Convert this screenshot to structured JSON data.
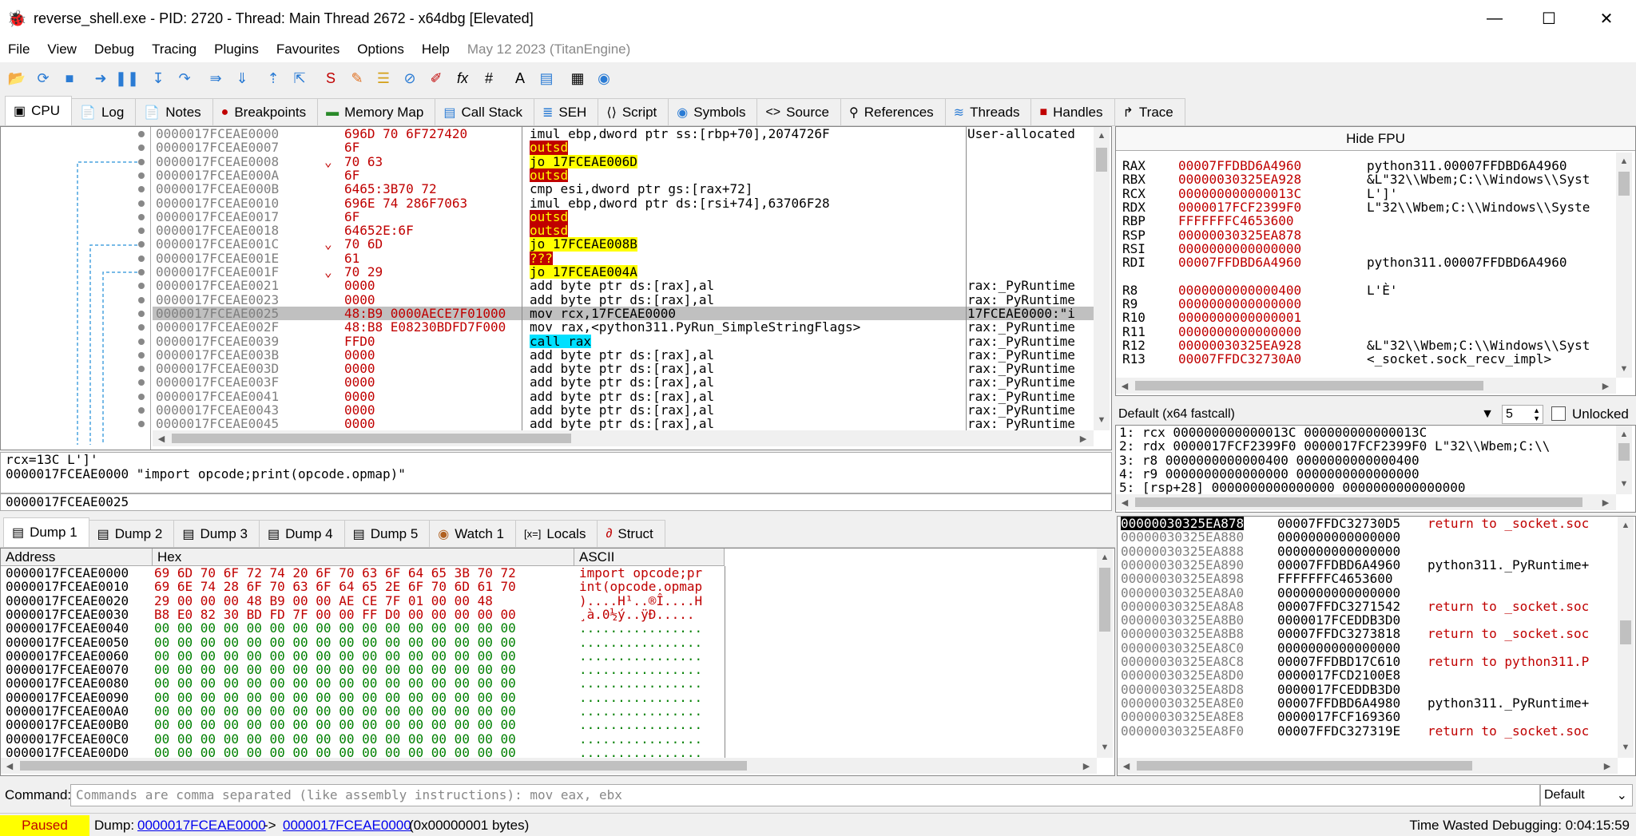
{
  "window": {
    "title": "reverse_shell.exe - PID: 2720 - Thread: Main Thread 2672 - x64dbg [Elevated]",
    "minimize": "—",
    "maximize": "☐",
    "close": "✕"
  },
  "menu": {
    "items": [
      "File",
      "View",
      "Debug",
      "Tracing",
      "Plugins",
      "Favourites",
      "Options",
      "Help"
    ],
    "date": "May 12 2023 (TitanEngine)"
  },
  "toolbar": {
    "icons": [
      "open-icon",
      "restart-icon",
      "close-icon",
      "run-icon",
      "pause-icon",
      "step-into-icon",
      "step-over-icon",
      "trace-into-icon",
      "trace-over-icon",
      "execute-till-return-icon",
      "run-to-user-code-icon",
      "scylla-icon",
      "patches-icon",
      "comments-icon",
      "labels-icon",
      "bookmarks-icon",
      "functions-icon",
      "variables-icon",
      "strings-icon",
      "calculator-icon",
      "help-icon"
    ]
  },
  "tabs": [
    {
      "label": "CPU",
      "icon": "cpu-icon"
    },
    {
      "label": "Log",
      "icon": "log-icon"
    },
    {
      "label": "Notes",
      "icon": "notes-icon"
    },
    {
      "label": "Breakpoints",
      "icon": "breakpoint-icon"
    },
    {
      "label": "Memory Map",
      "icon": "memory-icon"
    },
    {
      "label": "Call Stack",
      "icon": "callstack-icon"
    },
    {
      "label": "SEH",
      "icon": "seh-icon"
    },
    {
      "label": "Script",
      "icon": "script-icon"
    },
    {
      "label": "Symbols",
      "icon": "symbols-icon"
    },
    {
      "label": "Source",
      "icon": "source-icon"
    },
    {
      "label": "References",
      "icon": "references-icon"
    },
    {
      "label": "Threads",
      "icon": "threads-icon"
    },
    {
      "label": "Handles",
      "icon": "handles-icon"
    },
    {
      "label": "Trace",
      "icon": "trace-icon"
    }
  ],
  "disasm": {
    "rows": [
      {
        "addr": "0000017FCEAE0000",
        "mark": "",
        "bytes": "696D 70 6F727420",
        "ins": "imul ebp,dword ptr ss:[rbp+70],2074726F",
        "hl": "",
        "cmt": "User-allocated"
      },
      {
        "addr": "0000017FCEAE0007",
        "mark": "",
        "bytes": "6F",
        "ins": "outsd",
        "hl": "red",
        "cmt": ""
      },
      {
        "addr": "0000017FCEAE0008",
        "mark": "⌄",
        "bytes": "70 63",
        "ins": "jo 17FCEAE006D",
        "hl": "yellow",
        "cmt": ""
      },
      {
        "addr": "0000017FCEAE000A",
        "mark": "",
        "bytes": "6F",
        "ins": "outsd",
        "hl": "red",
        "cmt": ""
      },
      {
        "addr": "0000017FCEAE000B",
        "mark": "",
        "bytes": "6465:3B70 72",
        "ins": "cmp esi,dword ptr gs:[rax+72]",
        "hl": "",
        "cmt": ""
      },
      {
        "addr": "0000017FCEAE0010",
        "mark": "",
        "bytes": "696E 74 286F7063",
        "ins": "imul ebp,dword ptr ds:[rsi+74],63706F28",
        "hl": "",
        "cmt": ""
      },
      {
        "addr": "0000017FCEAE0017",
        "mark": "",
        "bytes": "6F",
        "ins": "outsd",
        "hl": "red",
        "cmt": ""
      },
      {
        "addr": "0000017FCEAE0018",
        "mark": "",
        "bytes": "64652E:6F",
        "ins": "outsd",
        "hl": "red",
        "cmt": ""
      },
      {
        "addr": "0000017FCEAE001C",
        "mark": "⌄",
        "bytes": "70 6D",
        "ins": "jo 17FCEAE008B",
        "hl": "yellow",
        "cmt": ""
      },
      {
        "addr": "0000017FCEAE001E",
        "mark": "",
        "bytes": "61",
        "ins": "???",
        "hl": "red",
        "cmt": ""
      },
      {
        "addr": "0000017FCEAE001F",
        "mark": "⌄",
        "bytes": "70 29",
        "ins": "jo 17FCEAE004A",
        "hl": "yellow",
        "cmt": ""
      },
      {
        "addr": "0000017FCEAE0021",
        "mark": "",
        "bytes": "0000",
        "ins": "add byte ptr ds:[rax],al",
        "hl": "",
        "cmt": "rax:_PyRuntime"
      },
      {
        "addr": "0000017FCEAE0023",
        "mark": "",
        "bytes": "0000",
        "ins": "add byte ptr ds:[rax],al",
        "hl": "",
        "cmt": "rax:_PyRuntime"
      },
      {
        "addr": "0000017FCEAE0025",
        "mark": "",
        "bytes": "48:B9 0000AECE7F01000",
        "ins": "mov rcx,17FCEAE0000",
        "hl": "sel",
        "cmt": "17FCEAE0000:\"i"
      },
      {
        "addr": "0000017FCEAE002F",
        "mark": "",
        "bytes": "48:B8 E08230BDFD7F000",
        "ins": "mov rax,<python311.PyRun_SimpleStringFlags>",
        "hl": "",
        "cmt": "rax:_PyRuntime"
      },
      {
        "addr": "0000017FCEAE0039",
        "mark": "",
        "bytes": "FFD0",
        "ins": "call rax",
        "hl": "cyan",
        "cmt": "rax:_PyRuntime"
      },
      {
        "addr": "0000017FCEAE003B",
        "mark": "",
        "bytes": "0000",
        "ins": "add byte ptr ds:[rax],al",
        "hl": "",
        "cmt": "rax:_PyRuntime"
      },
      {
        "addr": "0000017FCEAE003D",
        "mark": "",
        "bytes": "0000",
        "ins": "add byte ptr ds:[rax],al",
        "hl": "",
        "cmt": "rax:_PyRuntime"
      },
      {
        "addr": "0000017FCEAE003F",
        "mark": "",
        "bytes": "0000",
        "ins": "add byte ptr ds:[rax],al",
        "hl": "",
        "cmt": "rax:_PyRuntime"
      },
      {
        "addr": "0000017FCEAE0041",
        "mark": "",
        "bytes": "0000",
        "ins": "add byte ptr ds:[rax],al",
        "hl": "",
        "cmt": "rax:_PyRuntime"
      },
      {
        "addr": "0000017FCEAE0043",
        "mark": "",
        "bytes": "0000",
        "ins": "add byte ptr ds:[rax],al",
        "hl": "",
        "cmt": "rax:_PyRuntime"
      },
      {
        "addr": "0000017FCEAE0045",
        "mark": "",
        "bytes": "0000",
        "ins": "add byte ptr ds:[rax],al",
        "hl": "",
        "cmt": "rax:_PyRuntime"
      }
    ]
  },
  "info": {
    "line1": "rcx=13C L']'",
    "line2": "0000017FCEAE0000 \"import opcode;print(opcode.opmap)\"",
    "address": "0000017FCEAE0025"
  },
  "registers": {
    "hide_fpu": "Hide FPU",
    "rows": [
      {
        "name": "RAX",
        "value": "00007FFDBD6A4960",
        "comment": "python311.00007FFDBD6A4960",
        "changed": true
      },
      {
        "name": "RBX",
        "value": "00000030325EA928",
        "comment": "&L\"32\\\\Wbem;C:\\\\Windows\\\\Syst",
        "changed": true
      },
      {
        "name": "RCX",
        "value": "000000000000013C",
        "comment": "L']'",
        "changed": true
      },
      {
        "name": "RDX",
        "value": "0000017FCF2399F0",
        "comment": "L\"32\\\\Wbem;C:\\\\Windows\\\\Syste",
        "changed": true
      },
      {
        "name": "RBP",
        "value": "FFFFFFFC4653600",
        "comment": "",
        "changed": true
      },
      {
        "name": "RSP",
        "value": "00000030325EA878",
        "comment": "",
        "changed": true
      },
      {
        "name": "RSI",
        "value": "0000000000000000",
        "comment": "",
        "changed": true
      },
      {
        "name": "RDI",
        "value": "00007FFDBD6A4960",
        "comment": "python311.00007FFDBD6A4960",
        "changed": true
      },
      {
        "name": "",
        "value": "",
        "comment": "",
        "changed": false
      },
      {
        "name": "R8",
        "value": "0000000000000400",
        "comment": "L'È'",
        "changed": true
      },
      {
        "name": "R9",
        "value": "0000000000000000",
        "comment": "",
        "changed": true
      },
      {
        "name": "R10",
        "value": "0000000000000001",
        "comment": "",
        "changed": true
      },
      {
        "name": "R11",
        "value": "0000000000000000",
        "comment": "",
        "changed": true
      },
      {
        "name": "R12",
        "value": "00000030325EA928",
        "comment": "&L\"32\\\\Wbem;C:\\\\Windows\\\\Syst",
        "changed": true
      },
      {
        "name": "R13",
        "value": "00007FFDC32730A0",
        "comment": "<_socket.sock_recv_impl>",
        "changed": true
      }
    ]
  },
  "callconv": {
    "value": "Default (x64 fastcall)",
    "count": "5",
    "unlocked": "Unlocked"
  },
  "args": [
    "1: rcx 000000000000013C 000000000000013C",
    "2: rdx 0000017FCF2399F0 0000017FCF2399F0 L\"32\\\\Wbem;C:\\\\",
    "3: r8 0000000000000400 0000000000000400",
    "4: r9 0000000000000000 0000000000000000",
    "5: [rsp+28] 0000000000000000 0000000000000000"
  ],
  "dumptabs": [
    {
      "label": "Dump 1",
      "icon": "dump-icon"
    },
    {
      "label": "Dump 2",
      "icon": "dump-icon"
    },
    {
      "label": "Dump 3",
      "icon": "dump-icon"
    },
    {
      "label": "Dump 4",
      "icon": "dump-icon"
    },
    {
      "label": "Dump 5",
      "icon": "dump-icon"
    },
    {
      "label": "Watch 1",
      "icon": "watch-icon"
    },
    {
      "label": "Locals",
      "icon": "locals-icon"
    },
    {
      "label": "Struct",
      "icon": "struct-icon"
    }
  ],
  "dump": {
    "headers": {
      "address": "Address",
      "hex": "Hex",
      "ascii": "ASCII"
    },
    "rows": [
      {
        "addr": "0000017FCEAE0000",
        "hex": "69 6D 70 6F 72 74 20 6F 70 63 6F 64 65 3B 70 72",
        "ascii": "import opcode;pr",
        "red": true
      },
      {
        "addr": "0000017FCEAE0010",
        "hex": "69 6E 74 28 6F 70 63 6F 64 65 2E 6F 70 6D 61 70",
        "ascii": "int(opcode.opmap",
        "red": true
      },
      {
        "addr": "0000017FCEAE0020",
        "hex": "29 00 00 00 48 B9 00 00 AE CE 7F 01 00 00 48",
        "ascii": ")....H¹..®Î....H",
        "red": true
      },
      {
        "addr": "0000017FCEAE0030",
        "hex": "B8 E0 82 30 BD FD 7F 00 00 FF D0 00 00 00 00 00",
        "ascii": "¸à.0½ý..ÿÐ.....",
        "red": true
      },
      {
        "addr": "0000017FCEAE0040",
        "hex": "00 00 00 00 00 00 00 00 00 00 00 00 00 00 00 00",
        "ascii": "................",
        "red": false
      },
      {
        "addr": "0000017FCEAE0050",
        "hex": "00 00 00 00 00 00 00 00 00 00 00 00 00 00 00 00",
        "ascii": "................",
        "red": false
      },
      {
        "addr": "0000017FCEAE0060",
        "hex": "00 00 00 00 00 00 00 00 00 00 00 00 00 00 00 00",
        "ascii": "................",
        "red": false
      },
      {
        "addr": "0000017FCEAE0070",
        "hex": "00 00 00 00 00 00 00 00 00 00 00 00 00 00 00 00",
        "ascii": "................",
        "red": false
      },
      {
        "addr": "0000017FCEAE0080",
        "hex": "00 00 00 00 00 00 00 00 00 00 00 00 00 00 00 00",
        "ascii": "................",
        "red": false
      },
      {
        "addr": "0000017FCEAE0090",
        "hex": "00 00 00 00 00 00 00 00 00 00 00 00 00 00 00 00",
        "ascii": "................",
        "red": false
      },
      {
        "addr": "0000017FCEAE00A0",
        "hex": "00 00 00 00 00 00 00 00 00 00 00 00 00 00 00 00",
        "ascii": "................",
        "red": false
      },
      {
        "addr": "0000017FCEAE00B0",
        "hex": "00 00 00 00 00 00 00 00 00 00 00 00 00 00 00 00",
        "ascii": "................",
        "red": false
      },
      {
        "addr": "0000017FCEAE00C0",
        "hex": "00 00 00 00 00 00 00 00 00 00 00 00 00 00 00 00",
        "ascii": "................",
        "red": false
      },
      {
        "addr": "0000017FCEAE00D0",
        "hex": "00 00 00 00 00 00 00 00 00 00 00 00 00 00 00 00",
        "ascii": "................",
        "red": false
      }
    ]
  },
  "stack": {
    "rows": [
      {
        "addr": "00000030325EA878",
        "val": "00007FFDC32730D5",
        "cmt": "return to _socket.soc",
        "red": true,
        "sel": true
      },
      {
        "addr": "00000030325EA880",
        "val": "0000000000000000",
        "cmt": "",
        "red": false,
        "sel": false
      },
      {
        "addr": "00000030325EA888",
        "val": "0000000000000000",
        "cmt": "",
        "red": false,
        "sel": false
      },
      {
        "addr": "00000030325EA890",
        "val": "00007FFDBD6A4960",
        "cmt": "python311._PyRuntime+",
        "red": false,
        "sel": false
      },
      {
        "addr": "00000030325EA898",
        "val": "FFFFFFFC4653600",
        "cmt": "",
        "red": false,
        "sel": false
      },
      {
        "addr": "00000030325EA8A0",
        "val": "0000000000000000",
        "cmt": "",
        "red": false,
        "sel": false
      },
      {
        "addr": "00000030325EA8A8",
        "val": "00007FFDC3271542",
        "cmt": "return to _socket.soc",
        "red": true,
        "sel": false
      },
      {
        "addr": "00000030325EA8B0",
        "val": "0000017FCEDDB3D0",
        "cmt": "",
        "red": false,
        "sel": false
      },
      {
        "addr": "00000030325EA8B8",
        "val": "00007FFDC3273818",
        "cmt": "return to _socket.soc",
        "red": true,
        "sel": false
      },
      {
        "addr": "00000030325EA8C0",
        "val": "0000000000000000",
        "cmt": "",
        "red": false,
        "sel": false
      },
      {
        "addr": "00000030325EA8C8",
        "val": "00007FFDBD17C610",
        "cmt": "return to python311.P",
        "red": true,
        "sel": false
      },
      {
        "addr": "00000030325EA8D0",
        "val": "0000017FCD2100E8",
        "cmt": "",
        "red": false,
        "sel": false
      },
      {
        "addr": "00000030325EA8D8",
        "val": "0000017FCEDDB3D0",
        "cmt": "",
        "red": false,
        "sel": false
      },
      {
        "addr": "00000030325EA8E0",
        "val": "00007FFDBD6A4980",
        "cmt": "python311._PyRuntime+",
        "red": false,
        "sel": false
      },
      {
        "addr": "00000030325EA8E8",
        "val": "0000017FCF169360",
        "cmt": "",
        "red": false,
        "sel": false
      },
      {
        "addr": "00000030325EA8F0",
        "val": "00007FFDC327319E",
        "cmt": "return to _socket.soc",
        "red": true,
        "sel": false
      }
    ]
  },
  "command": {
    "label": "Command:",
    "placeholder": "Commands are comma separated (like assembly instructions): mov eax, ebx",
    "mode": "Default"
  },
  "status": {
    "state": "Paused",
    "dump_label": "Dump:",
    "from": "0000017FCEAE0000",
    "arrow": "->",
    "to": "0000017FCEAE0000",
    "size": "(0x00000001 bytes)",
    "time": "Time Wasted Debugging: 0:04:15:59"
  }
}
